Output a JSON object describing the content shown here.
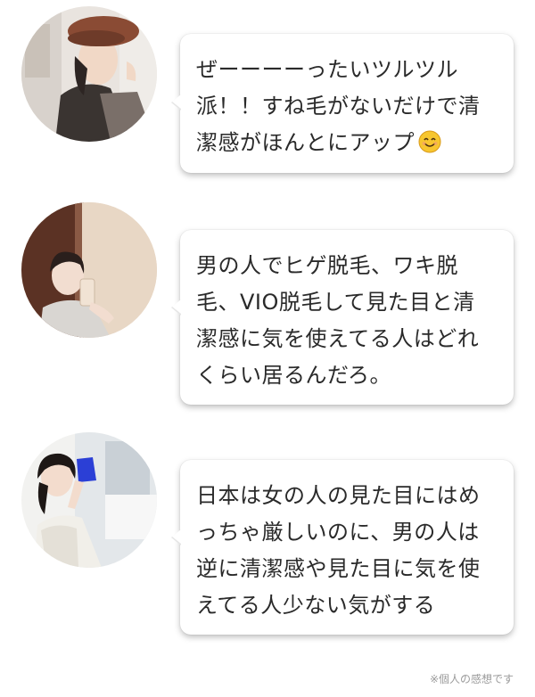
{
  "testimonials": [
    {
      "avatar_icon": "woman-beret-photo",
      "text": "ぜーーーーったいツルツル\n派！！すね毛がないだけで清\n潔感がほんとにアップ",
      "emoji": "smiling-face-emoji"
    },
    {
      "avatar_icon": "woman-mirror-selfie-photo",
      "text": "男の人でヒゲ脱毛、ワキ脱\n毛、VIO脱毛して見た目と清\n潔感に気を使えてる人はどれ\nくらい居るんだろ。"
    },
    {
      "avatar_icon": "woman-holding-cup-photo",
      "text": "日本は女の人の見た目にはめ\nっちゃ厳しいのに、男の人は\n逆に清潔感や見た目に気を使\nえてる人少ない気がする"
    }
  ],
  "footnote": "※個人の感想です"
}
